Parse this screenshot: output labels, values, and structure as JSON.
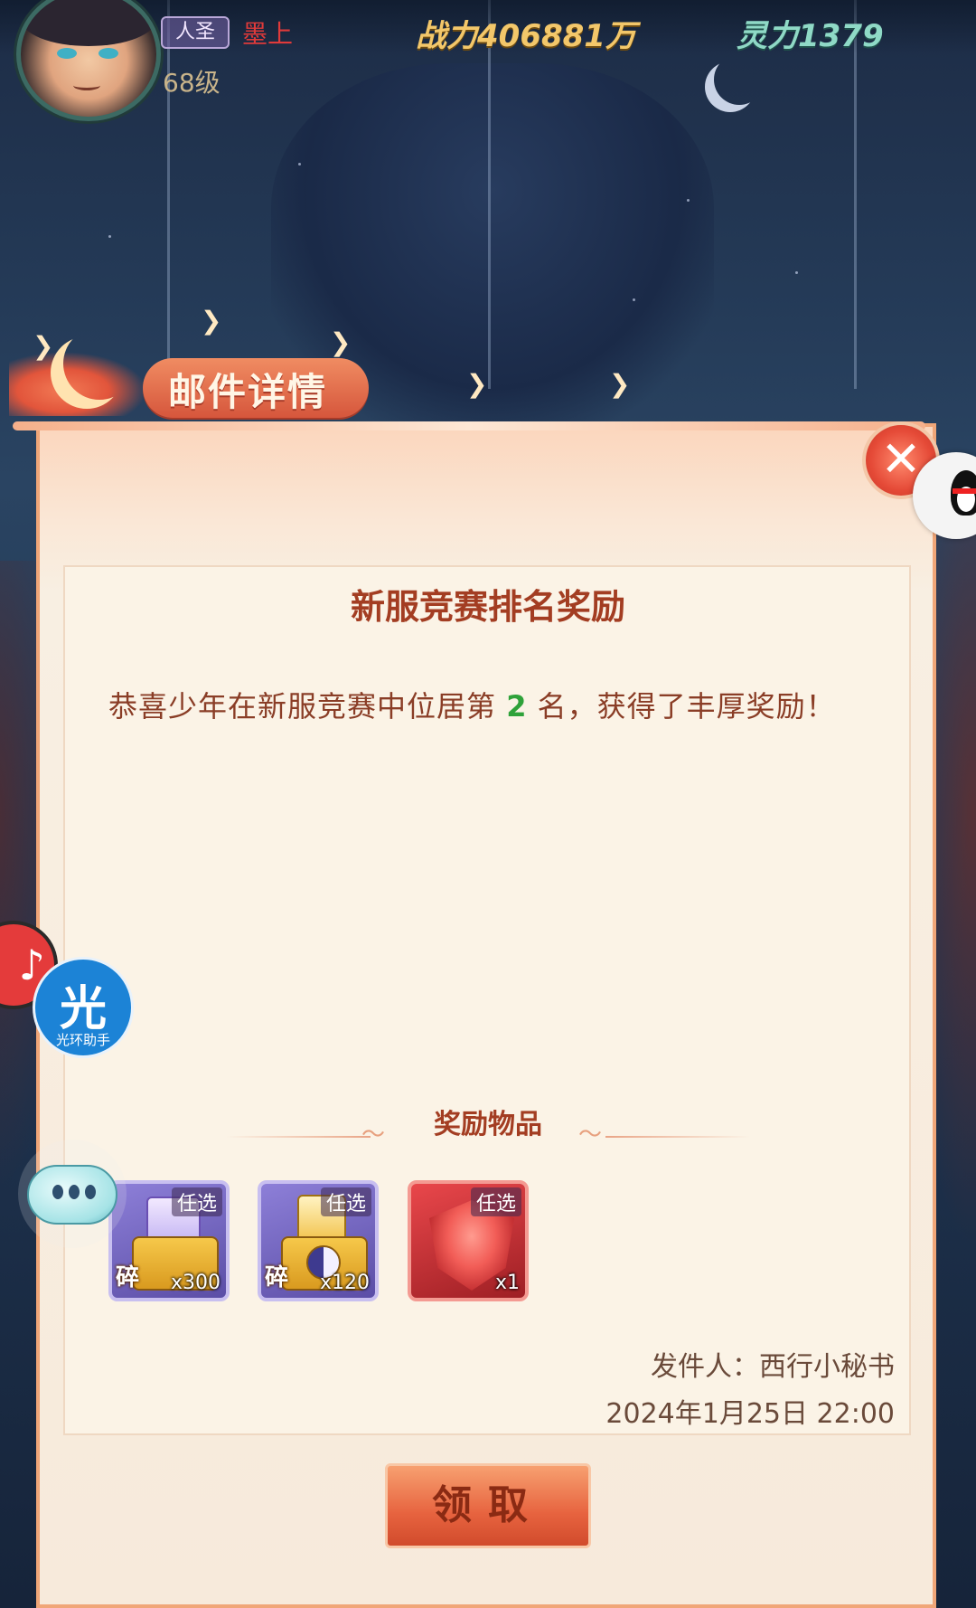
{
  "hud": {
    "rank_badge": "人圣",
    "player_name": "墨上",
    "level": "68级",
    "power": "战力406881万",
    "spirit": "灵力1379"
  },
  "dialog": {
    "title": "邮件详情",
    "close_icon": "✕",
    "mail_title": "新服竞赛排名奖励",
    "body_prefix": "恭喜少年在新服竞赛中位居第 ",
    "body_rank": "2",
    "body_suffix": " 名，获得了丰厚奖励！",
    "rewards_header": "奖励物品",
    "sender": "发件人：西行小秘书",
    "timestamp": "2024年1月25日 22:00",
    "claim_button": "领取"
  },
  "rewards": [
    {
      "tag": "任选",
      "frag": "碎",
      "qty": "x300",
      "icon": "hero-shard-chest-icon"
    },
    {
      "tag": "任选",
      "frag": "碎",
      "qty": "x120",
      "icon": "pet-shard-chest-icon"
    },
    {
      "tag": "任选",
      "frag": "",
      "qty": "x1",
      "icon": "red-armor-icon"
    }
  ],
  "overlays": {
    "helper_glyph": "光",
    "helper_label": "光环助手"
  },
  "colors": {
    "accent_red": "#e54a37",
    "title_brown": "#a33d22",
    "highlight_green": "#2fa23a",
    "power_gold": "#f3c76a",
    "spirit_teal": "#8fd9c6"
  }
}
